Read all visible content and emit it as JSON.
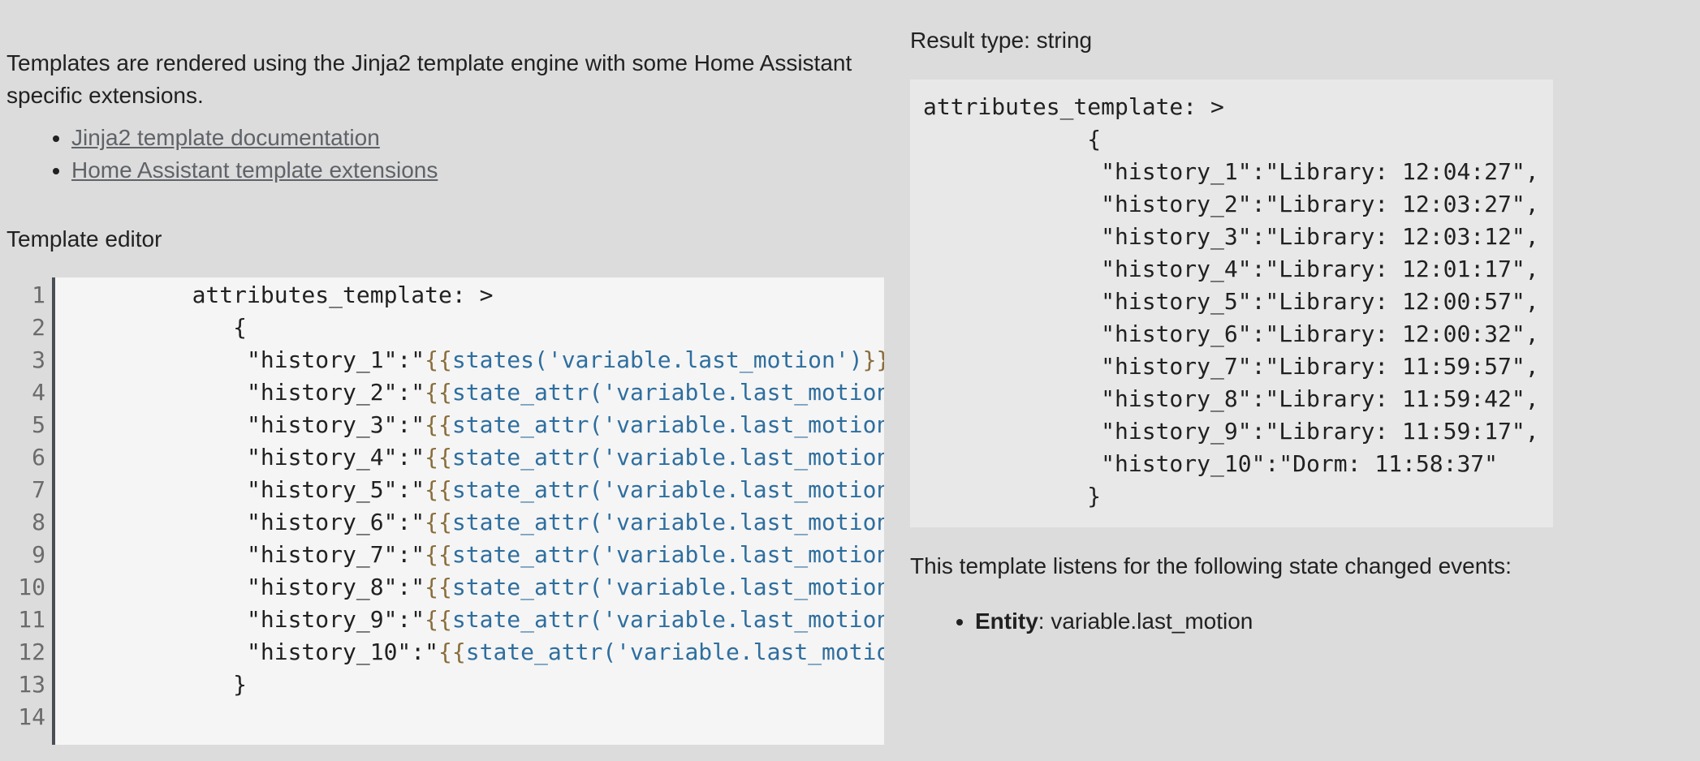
{
  "intro": {
    "text": "Templates are rendered using the Jinja2 template engine with some Home Assistant specific extensions."
  },
  "links": [
    {
      "label": "Jinja2 template documentation"
    },
    {
      "label": "Home Assistant template extensions"
    }
  ],
  "editor": {
    "label": "Template editor",
    "lines": [
      {
        "n": "1",
        "pre": "          attributes_template: >",
        "brace_open": "",
        "expr": "",
        "brace_close": ""
      },
      {
        "n": "2",
        "pre": "             {",
        "brace_open": "",
        "expr": "",
        "brace_close": ""
      },
      {
        "n": "3",
        "pre": "              \"history_1\":\"",
        "brace_open": "{{",
        "expr": "states('variable.last_motion')",
        "brace_close": "}}"
      },
      {
        "n": "4",
        "pre": "              \"history_2\":\"",
        "brace_open": "{{",
        "expr": "state_attr('variable.last_motion",
        "brace_close": ""
      },
      {
        "n": "5",
        "pre": "              \"history_3\":\"",
        "brace_open": "{{",
        "expr": "state_attr('variable.last_motion",
        "brace_close": ""
      },
      {
        "n": "6",
        "pre": "              \"history_4\":\"",
        "brace_open": "{{",
        "expr": "state_attr('variable.last_motion",
        "brace_close": ""
      },
      {
        "n": "7",
        "pre": "              \"history_5\":\"",
        "brace_open": "{{",
        "expr": "state_attr('variable.last_motion",
        "brace_close": ""
      },
      {
        "n": "8",
        "pre": "              \"history_6\":\"",
        "brace_open": "{{",
        "expr": "state_attr('variable.last_motion",
        "brace_close": ""
      },
      {
        "n": "9",
        "pre": "              \"history_7\":\"",
        "brace_open": "{{",
        "expr": "state_attr('variable.last_motion",
        "brace_close": ""
      },
      {
        "n": "10",
        "pre": "              \"history_8\":\"",
        "brace_open": "{{",
        "expr": "state_attr('variable.last_motion",
        "brace_close": ""
      },
      {
        "n": "11",
        "pre": "              \"history_9\":\"",
        "brace_open": "{{",
        "expr": "state_attr('variable.last_motion",
        "brace_close": ""
      },
      {
        "n": "12",
        "pre": "              \"history_10\":\"",
        "brace_open": "{{",
        "expr": "state_attr('variable.last_motio",
        "brace_close": ""
      },
      {
        "n": "13",
        "pre": "             }",
        "brace_open": "",
        "expr": "",
        "brace_close": ""
      },
      {
        "n": "14",
        "pre": "",
        "brace_open": "",
        "expr": "",
        "brace_close": ""
      }
    ]
  },
  "result": {
    "type_label": "Result type: string",
    "output": "attributes_template: >\n            {\n             \"history_1\":\"Library: 12:04:27\",\n             \"history_2\":\"Library: 12:03:27\",\n             \"history_3\":\"Library: 12:03:12\",\n             \"history_4\":\"Library: 12:01:17\",\n             \"history_5\":\"Library: 12:00:57\",\n             \"history_6\":\"Library: 12:00:32\",\n             \"history_7\":\"Library: 11:59:57\",\n             \"history_8\":\"Library: 11:59:42\",\n             \"history_9\":\"Library: 11:59:17\",\n             \"history_10\":\"Dorm: 11:58:37\"\n            }"
  },
  "listens": {
    "text": "This template listens for the following state changed events:",
    "entities": [
      {
        "kind": "Entity",
        "sep": ": ",
        "value": "variable.last_motion"
      }
    ]
  },
  "colors": {
    "background": "#dcdcdc",
    "editor_bg": "#f5f5f5",
    "result_bg": "#e8e8e8",
    "template_brace": "#8a6d3b",
    "template_expr": "#2e6e9e",
    "link": "#5f6368"
  }
}
